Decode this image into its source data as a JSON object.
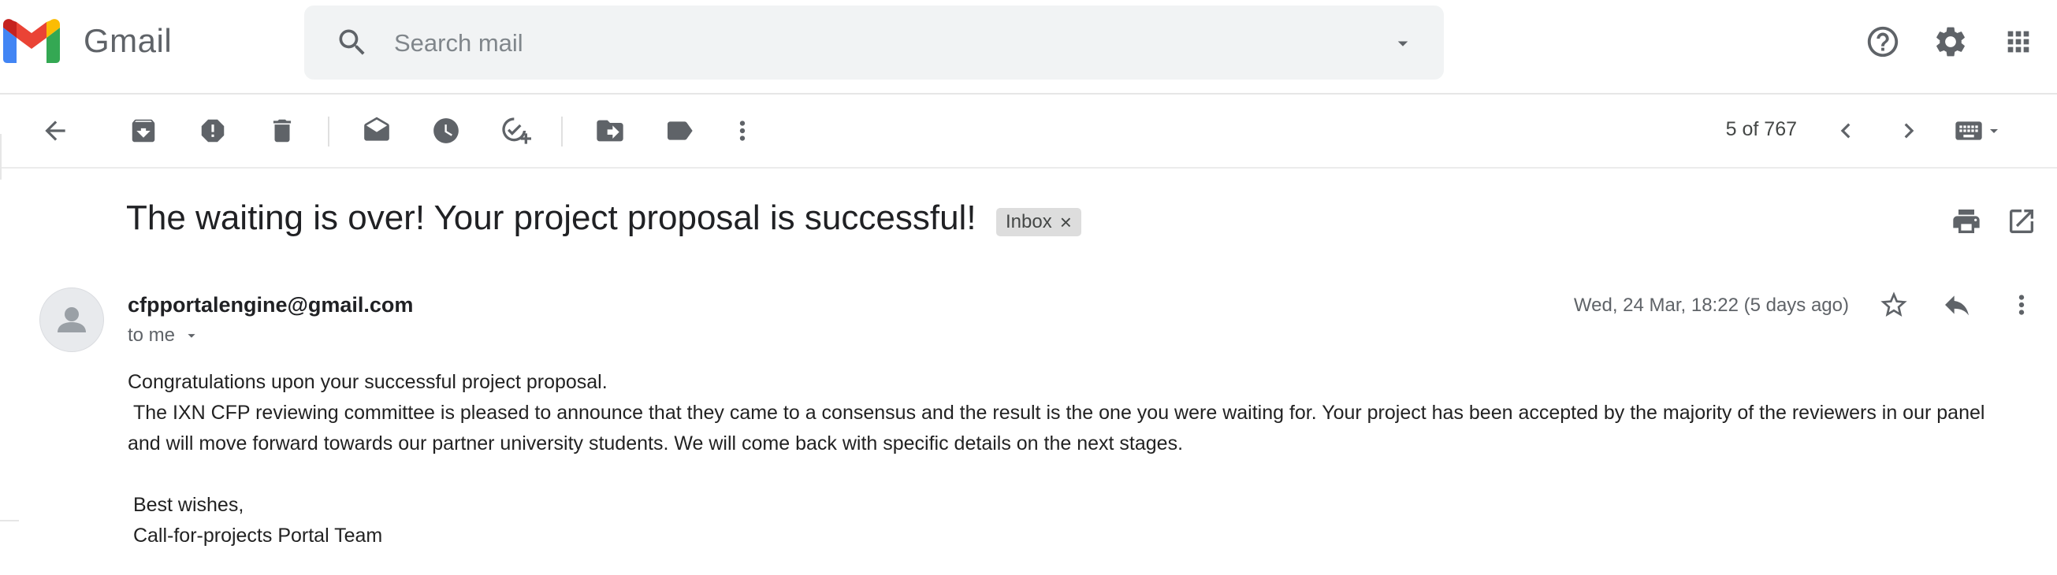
{
  "header": {
    "brand": "Gmail",
    "search": {
      "placeholder": "Search mail",
      "value": ""
    },
    "icons": [
      "gmail-logo",
      "search-icon",
      "search-options-icon",
      "help-icon",
      "settings-icon",
      "apps-icon"
    ]
  },
  "toolbar": {
    "pager": "5 of 767",
    "actions": [
      "back",
      "archive",
      "report-spam",
      "delete",
      "mark-unread",
      "snooze",
      "add-to-tasks",
      "move-to",
      "labels",
      "more",
      "newer",
      "older",
      "input-tools"
    ]
  },
  "email": {
    "subject": "The waiting is over! Your project proposal is successful!",
    "label": "Inbox",
    "label_remove": "×",
    "sender": "cfpportalengine@gmail.com",
    "recipient": "to me",
    "date": "Wed, 24 Mar, 18:22 (5 days ago)",
    "body": [
      "Congratulations upon your successful project proposal.",
      " The IXN CFP reviewing committee is pleased to announce that they came to a consensus and the result is the one you were waiting for. Your project has been accepted by the majority of the reviewers in our panel and will move forward towards our partner university students. We will come back with specific details on the next stages.",
      "",
      " Best wishes,",
      " Call-for-projects Portal Team"
    ]
  },
  "colors": {
    "gmail_red": "#EA4335",
    "gmail_blue": "#4285F4",
    "gmail_green": "#34A853",
    "gmail_yellow": "#FBBC04",
    "icon_gray": "#5f6368",
    "search_bg": "#f1f3f4",
    "badge_bg": "#dddddd"
  }
}
